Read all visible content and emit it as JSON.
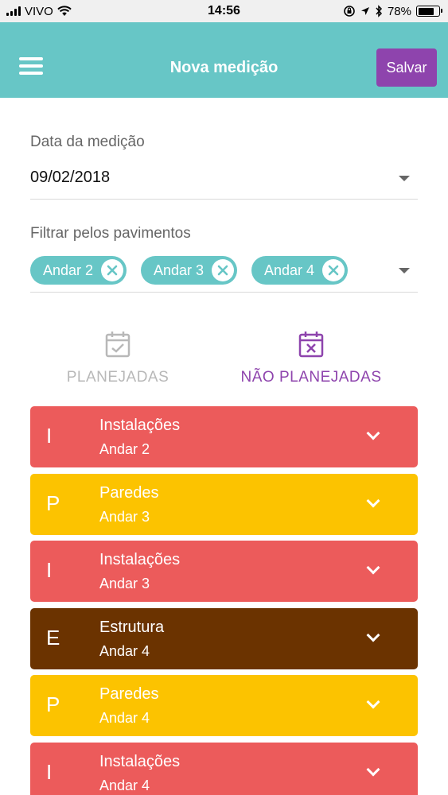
{
  "status_bar": {
    "carrier": "VIVO",
    "time": "14:56",
    "battery_percent": "78%",
    "battery_level": 0.78,
    "icons": [
      "signal-icon",
      "wifi-icon",
      "orientation-lock-icon",
      "location-icon",
      "bluetooth-icon",
      "battery-icon"
    ]
  },
  "header": {
    "title": "Nova medição",
    "save_label": "Salvar",
    "background_color": "#67c6c6",
    "save_color": "#8e44ad"
  },
  "form": {
    "date_label": "Data da medição",
    "date_value": "09/02/2018",
    "filter_label": "Filtrar pelos pavimentos",
    "filter_chips": [
      "Andar 2",
      "Andar 3",
      "Andar 4"
    ]
  },
  "tabs": [
    {
      "label": "PLANEJADAS",
      "icon": "calendar-check-icon",
      "active": false
    },
    {
      "label": "NÃO PLANEJADAS",
      "icon": "calendar-x-icon",
      "active": true
    }
  ],
  "colors": {
    "accent": "#67c6c6",
    "active_tab": "#8e44ad",
    "inactive_tab": "#b8b8b8"
  },
  "items": [
    {
      "initial": "I",
      "title": "Instalações",
      "subtitle": "Andar 2",
      "color": "#ec5b5b"
    },
    {
      "initial": "P",
      "title": "Paredes",
      "subtitle": "Andar 3",
      "color": "#fcc300"
    },
    {
      "initial": "I",
      "title": "Instalações",
      "subtitle": "Andar 3",
      "color": "#ec5b5b"
    },
    {
      "initial": "E",
      "title": "Estrutura",
      "subtitle": "Andar 4",
      "color": "#6b3300"
    },
    {
      "initial": "P",
      "title": "Paredes",
      "subtitle": "Andar 4",
      "color": "#fcc300"
    },
    {
      "initial": "I",
      "title": "Instalações",
      "subtitle": "Andar 4",
      "color": "#ec5b5b"
    }
  ]
}
